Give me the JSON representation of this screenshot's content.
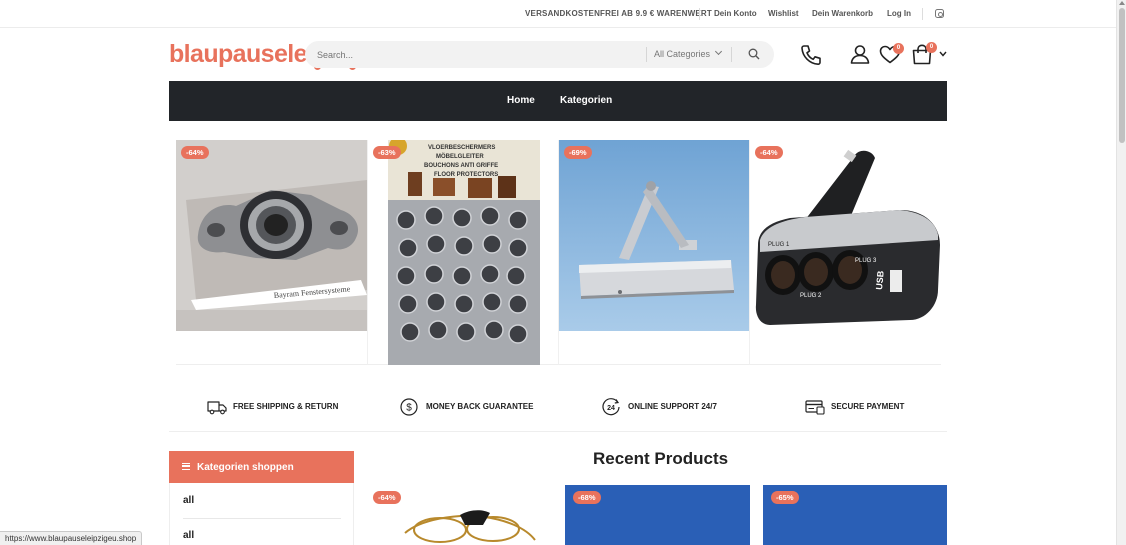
{
  "topbar": {
    "promo": "VERSANDKOSTENFREI AB 9.9 € WARENWERT",
    "links": [
      "Dein Konto",
      "Wishlist",
      "Dein Warenkorb",
      "Log In"
    ],
    "social_icon": "instagram-icon"
  },
  "header": {
    "logo": "blaupauseleipzig",
    "search_placeholder": "Search...",
    "category_select": "All Categories",
    "wishlist_count": "0",
    "cart_count": "0",
    "icons": [
      "phone-icon",
      "user-icon",
      "heart-icon",
      "cart-icon",
      "chevron-down-icon"
    ]
  },
  "nav": {
    "items": [
      "Home",
      "Kategorien"
    ]
  },
  "products": [
    {
      "sale": "-64%",
      "image": "bearing"
    },
    {
      "sale": "-63%",
      "image": "furniture-glides"
    },
    {
      "sale": "-69%",
      "image": "door-closer"
    },
    {
      "sale": "-64%",
      "image": "car-socket-splitter"
    }
  ],
  "features": [
    {
      "icon": "truck-icon",
      "label": "FREE SHIPPING & RETURN"
    },
    {
      "icon": "dollar-coin-icon",
      "label": "MONEY BACK GUARANTEE"
    },
    {
      "icon": "support-24-icon",
      "label": "ONLINE SUPPORT 24/7"
    },
    {
      "icon": "credit-card-icon",
      "label": "SECURE PAYMENT"
    }
  ],
  "sidebar": {
    "title": "Kategorien shoppen",
    "items": [
      "all",
      "all"
    ]
  },
  "recent": {
    "title": "Recent Products",
    "items": [
      {
        "sale": "-64%"
      },
      {
        "sale": "-68%"
      },
      {
        "sale": "-65%"
      }
    ]
  },
  "status_bar": "https://www.blaupauseleipzigeu.shop",
  "colors": {
    "accent": "#e8725c",
    "nav_bg": "#222529"
  }
}
